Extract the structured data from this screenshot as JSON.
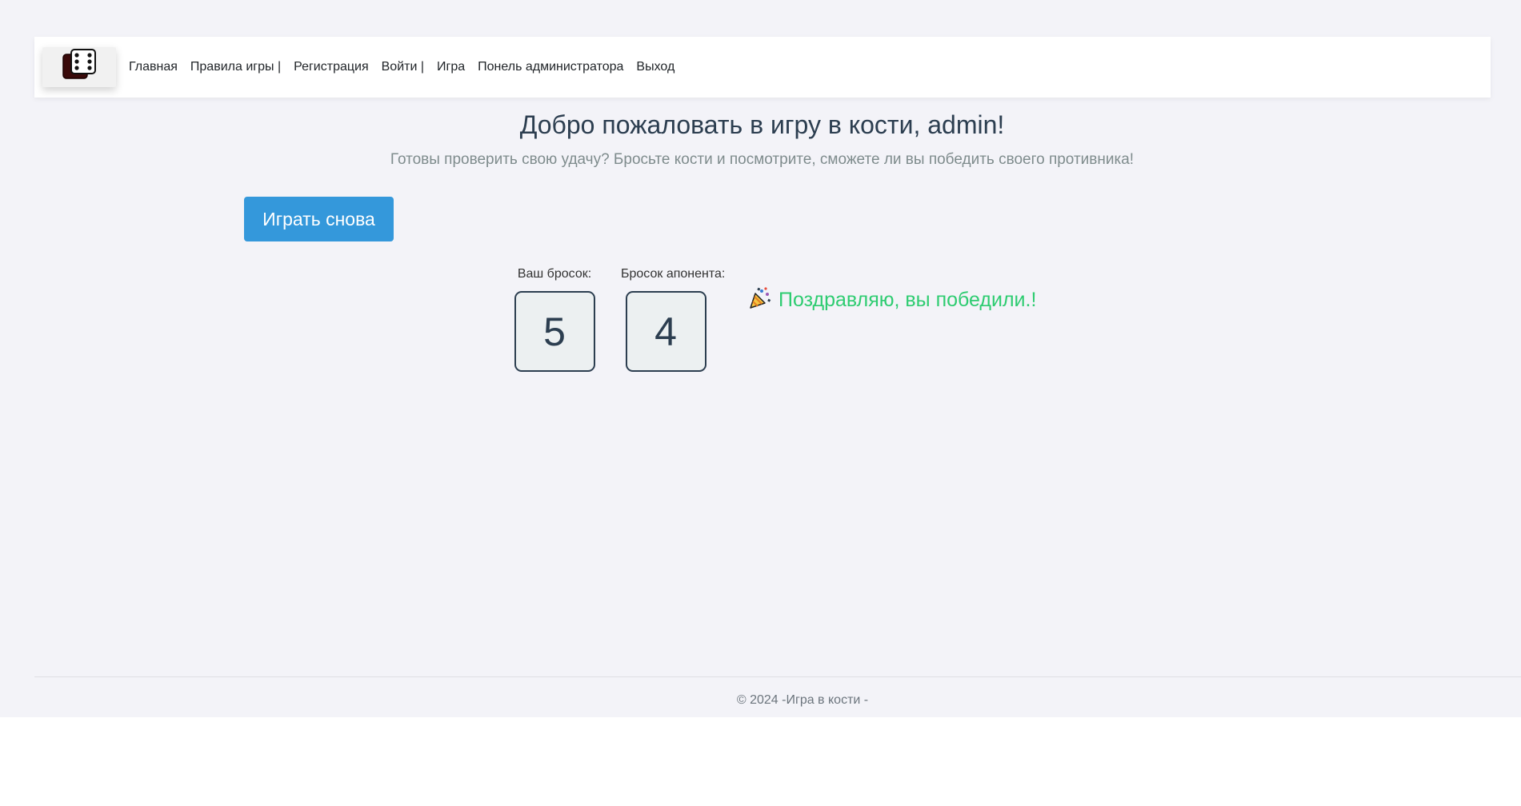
{
  "navbar": {
    "logo_icon": "dice-logo-icon",
    "links": [
      "Главная",
      "Правила игры |",
      "Регистрация",
      "Войти |",
      "Игра",
      "Понель администратора",
      "Выход"
    ]
  },
  "main": {
    "title": "Добро пожаловать в игру в кости, admin!",
    "subtitle": "Готовы проверить свою удачу? Бросьте кости и посмотрите, сможете ли вы победить своего противника!",
    "play_again_label": "Играть снова",
    "your_roll_label": "Ваш бросок:",
    "your_roll_value": "5",
    "opponent_roll_label": "Бросок апонента:",
    "opponent_roll_value": "4",
    "result_icon": "party-popper-icon",
    "result_text": "Поздравляю, вы победили.!"
  },
  "footer": {
    "text": "© 2024 -Игра в кости -"
  },
  "colors": {
    "background": "#f3f3f8",
    "accent_button": "#3498db",
    "win_text": "#2ecc71",
    "title": "#2c3e50",
    "subtitle": "#7f8c8d"
  }
}
